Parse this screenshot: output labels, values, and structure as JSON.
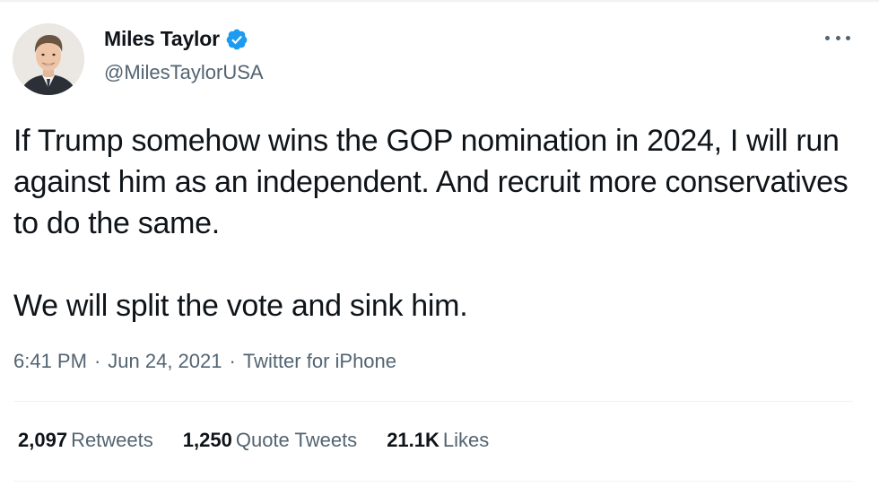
{
  "colors": {
    "text_primary": "#0f1419",
    "text_secondary": "#536471",
    "verified_blue": "#1d9bf0",
    "divider": "#eff3f4"
  },
  "author": {
    "display_name": "Miles Taylor",
    "handle": "@MilesTaylorUSA",
    "verified_icon": "verified-badge-icon",
    "avatar_icon": "avatar-photo"
  },
  "more_icon": "more-options-icon",
  "tweet": {
    "paragraphs": [
      "If Trump somehow wins the GOP nomination in 2024, I will run against him as an independent. And recruit more conservatives to do the same.",
      "We will split the vote and sink him."
    ]
  },
  "meta": {
    "time": "6:41 PM",
    "sep1": "·",
    "date": "Jun 24, 2021",
    "sep2": "·",
    "source": "Twitter for iPhone"
  },
  "stats": [
    {
      "value": "2,097",
      "label": "Retweets"
    },
    {
      "value": "1,250",
      "label": "Quote Tweets"
    },
    {
      "value": "21.1K",
      "label": "Likes"
    }
  ]
}
